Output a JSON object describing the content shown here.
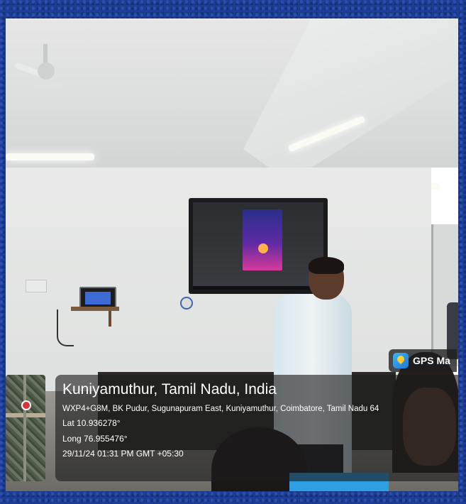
{
  "app": {
    "badge_label": "GPS Ma",
    "badge_icon": "map-pin-icon"
  },
  "location": {
    "title": "Kuniyamuthur, Tamil Nadu, India",
    "address": "WXP4+G8M, BK Pudur, Sugunapuram East, Kuniyamuthur, Coimbatore, Tamil Nadu 64",
    "lat": "Lat 10.936278°",
    "long": "Long 76.955476°",
    "timestamp": "29/11/24 01:31 PM GMT +05:30"
  },
  "colors": {
    "border_blue": "#1d3d93",
    "overlay": "#1c1c1c",
    "badge_icon_blue": "#2277d6"
  }
}
